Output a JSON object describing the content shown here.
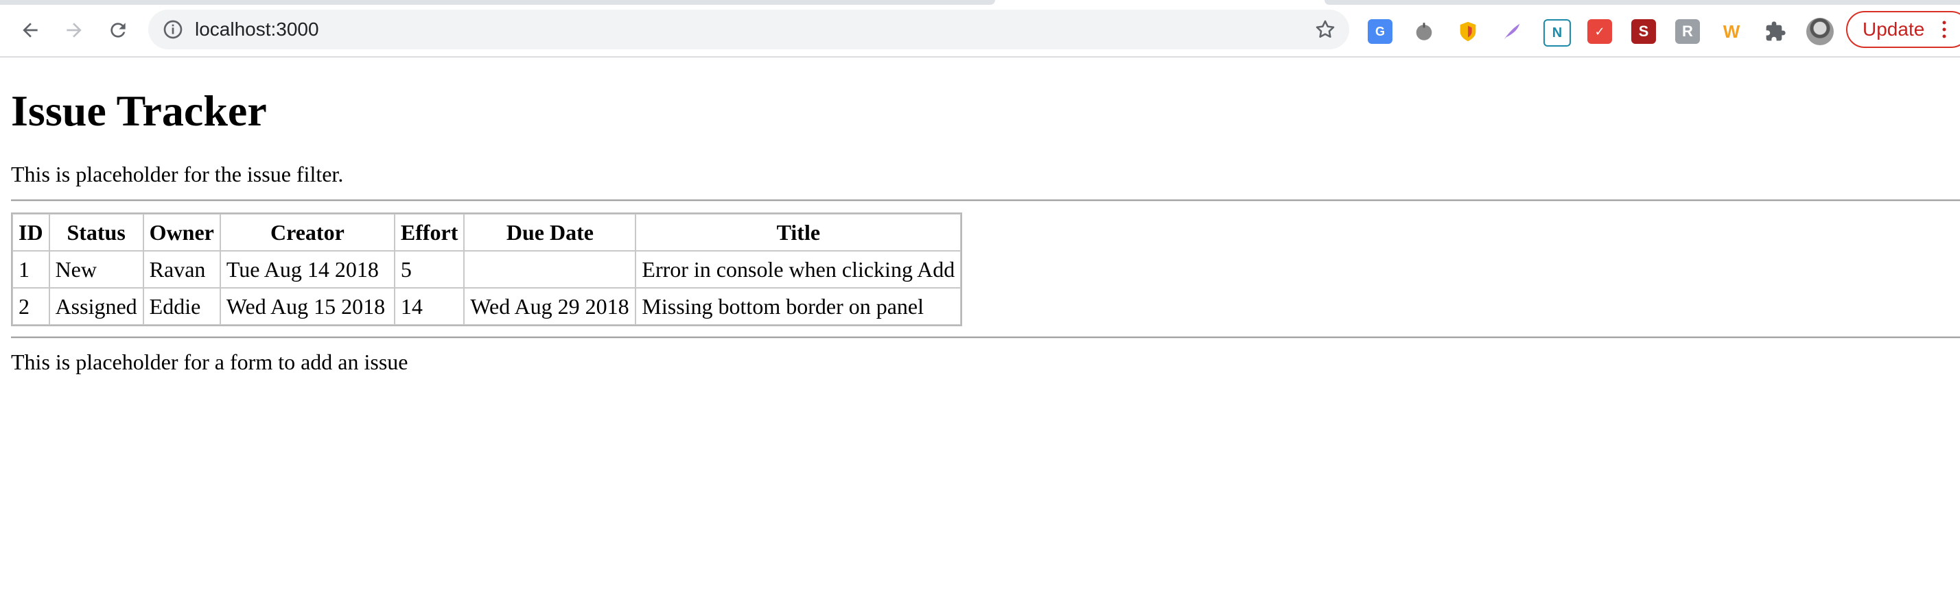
{
  "browser": {
    "url": "localhost:3000",
    "update_label": "Update",
    "extensions": [
      "google-translate-icon",
      "tomato-timer-icon",
      "brave-shield-icon",
      "quill-pen-icon",
      "notion-n-icon",
      "calendar-icon",
      "s-extension-icon",
      "r-extension-icon",
      "w-extension-icon",
      "puzzle-extensions-icon"
    ]
  },
  "page": {
    "title": "Issue Tracker",
    "filter_placeholder": "This is placeholder for the issue filter.",
    "add_placeholder": "This is placeholder for a form to add an issue"
  },
  "table": {
    "headers": [
      "ID",
      "Status",
      "Owner",
      "Creator",
      "Effort",
      "Due Date",
      "Title"
    ],
    "rows": [
      [
        "1",
        "New",
        "Ravan",
        "Tue Aug 14 2018",
        "5",
        "",
        "Error in console when clicking Add"
      ],
      [
        "2",
        "Assigned",
        "Eddie",
        "Wed Aug 15 2018",
        "14",
        "Wed Aug 29 2018",
        "Missing bottom border on panel"
      ]
    ]
  }
}
